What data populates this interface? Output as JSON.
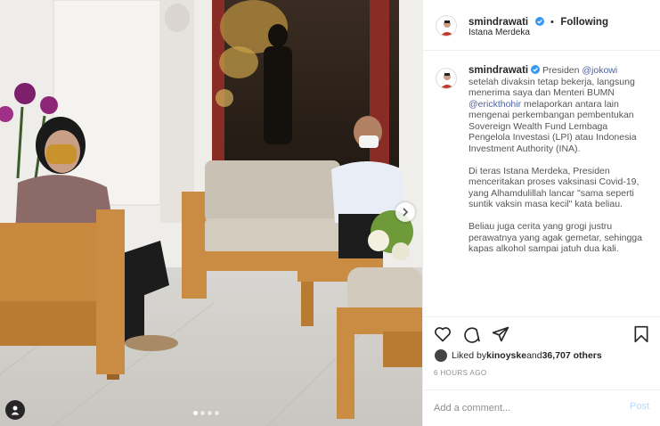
{
  "post": {
    "username": "smindrawati",
    "follow_separator": "•",
    "follow_label": "Following",
    "location": "Istana Merdeka"
  },
  "caption": {
    "username": "smindrawati",
    "p1_a": "Presiden ",
    "p1_mention1": "@jokowi",
    "p1_b": " setelah divaksin tetap bekerja, langsung menerima saya dan Menteri BUMN ",
    "p1_mention2": "@erickthohir",
    "p1_c": " melaporkan antara lain mengenai perkembangan pembentukan Sovereign Wealth Fund Lembaga Pengelola Investasi (LPI) atau Indonesia Investment Authority (INA).",
    "p2": "Di teras Istana Merdeka, Presiden menceritakan proses vaksinasi Covid-19, yang Alhamdulillah lancar \"sama seperti suntik vaksin masa kecil\" kata beliau.",
    "p3": "Beliau juga cerita yang grogi justru perawatnya yang agak gemetar, sehingga kapas alkohol sampai jatuh dua kali."
  },
  "likes": {
    "prefix": "Liked by ",
    "user": "kinoyske",
    "middle": " and ",
    "count": "36,707 others"
  },
  "timestamp": "6 HOURS AGO",
  "comment": {
    "placeholder": "Add a comment...",
    "post_label": "Post"
  },
  "carousel": {
    "total": 4,
    "current": 1
  },
  "colors": {
    "verified": "#3897f0",
    "mention": "#4d63a0",
    "post_disabled": "#b3dbff"
  },
  "icons": [
    "verified-badge-icon",
    "heart-icon",
    "comment-icon",
    "share-icon",
    "bookmark-icon",
    "chevron-right-icon",
    "user-tag-icon"
  ]
}
